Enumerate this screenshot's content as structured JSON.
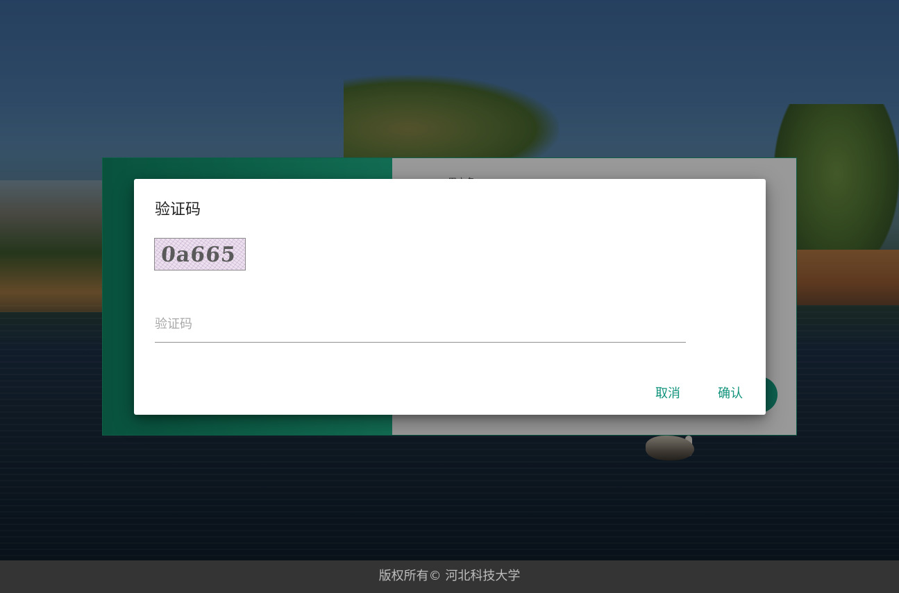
{
  "login": {
    "username_label": "用户名"
  },
  "dialog": {
    "title": "验证码",
    "captcha_text": "0a665",
    "input_placeholder": "验证码",
    "input_value": "",
    "cancel_label": "取消",
    "confirm_label": "确认"
  },
  "footer": {
    "text": "版权所有© 河北科技大学"
  },
  "colors": {
    "accent": "#12937c",
    "brand_green": "#16a084",
    "footer_bg": "#343434"
  }
}
